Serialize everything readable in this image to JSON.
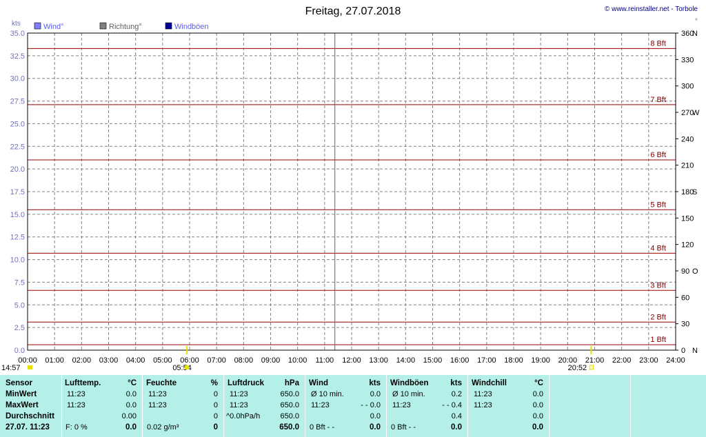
{
  "chart_data": {
    "type": "line",
    "title": "Freitag, 27.07.2018",
    "credit": "© www.reinstaller.net - Torbole",
    "legend": [
      {
        "label": "Wind°",
        "color": "#8080ff",
        "text_color": "#5a5aff"
      },
      {
        "label": "Richtung°",
        "color": "#808080",
        "text_color": "#606060"
      },
      {
        "label": "Windböen",
        "color": "#000099",
        "text_color": "#5a5aff"
      }
    ],
    "y_left": {
      "unit": "kts",
      "min": 0,
      "max": 35,
      "step": 2.5,
      "ticks": [
        "0.0",
        "2.5",
        "5.0",
        "7.5",
        "10.0",
        "12.5",
        "15.0",
        "17.5",
        "20.0",
        "22.5",
        "25.0",
        "27.5",
        "30.0",
        "32.5",
        "35.0"
      ]
    },
    "y_right": {
      "unit": "°",
      "min": 0,
      "max": 360,
      "step": 30,
      "ticks": [
        {
          "v": 0,
          "label": "0",
          "dir": "N"
        },
        {
          "v": 30,
          "label": "30",
          "dir": ""
        },
        {
          "v": 60,
          "label": "60",
          "dir": ""
        },
        {
          "v": 90,
          "label": "90",
          "dir": "O"
        },
        {
          "v": 120,
          "label": "120",
          "dir": ""
        },
        {
          "v": 150,
          "label": "150",
          "dir": ""
        },
        {
          "v": 180,
          "label": "180",
          "dir": "S"
        },
        {
          "v": 210,
          "label": "210",
          "dir": ""
        },
        {
          "v": 240,
          "label": "240",
          "dir": ""
        },
        {
          "v": 270,
          "label": "270",
          "dir": "W"
        },
        {
          "v": 300,
          "label": "300",
          "dir": ""
        },
        {
          "v": 330,
          "label": "330",
          "dir": ""
        },
        {
          "v": 360,
          "label": "360",
          "dir": "N"
        }
      ]
    },
    "x": {
      "min_hours": 0,
      "max_hours": 24,
      "ticks": [
        "00:00",
        "01:00",
        "02:00",
        "03:00",
        "04:00",
        "05:00",
        "06:00",
        "07:00",
        "08:00",
        "09:00",
        "10:00",
        "11:00",
        "12:00",
        "13:00",
        "14:00",
        "15:00",
        "16:00",
        "17:00",
        "18:00",
        "19:00",
        "20:00",
        "21:00",
        "22:00",
        "23:00",
        "24:00"
      ]
    },
    "beaufort": [
      {
        "label": "1 Bft",
        "kts": 0.6
      },
      {
        "label": "2 Bft",
        "kts": 3.1
      },
      {
        "label": "3 Bft",
        "kts": 6.6
      },
      {
        "label": "4 Bft",
        "kts": 10.7
      },
      {
        "label": "5 Bft",
        "kts": 15.5
      },
      {
        "label": "6 Bft",
        "kts": 21.0
      },
      {
        "label": "7 Bft",
        "kts": 27.1
      },
      {
        "label": "8 Bft",
        "kts": 33.3
      }
    ],
    "current_time_hours": 11.38,
    "sunrise": {
      "label": "05:54",
      "hours": 5.9
    },
    "sunset": {
      "label": "20:52",
      "hours": 20.87
    },
    "day_start": "14:57",
    "grid": true,
    "series": []
  },
  "table": {
    "row_labels": [
      "Sensor",
      "MinWert",
      "MaxWert",
      "Durchschnitt",
      "27.07. 11:23"
    ],
    "groups": [
      {
        "title": "Lufttemp.",
        "unit": "°C",
        "min": [
          "11:23",
          "0.0"
        ],
        "max": [
          "11:23",
          "0.0"
        ],
        "avg": "0.00",
        "cur": [
          "F: 0 %",
          "0.0"
        ]
      },
      {
        "title": "Feuchte",
        "unit": "%",
        "min": [
          "11:23",
          "0"
        ],
        "max": [
          "11:23",
          "0"
        ],
        "avg": "0",
        "cur": [
          "0.02 g/m³",
          "0"
        ]
      },
      {
        "title": "Luftdruck",
        "unit": "hPa",
        "min": [
          "11:23",
          "650.0"
        ],
        "max": [
          "11:23",
          "650.0"
        ],
        "avg_left": "^0.0hPa/h",
        "avg": "650.0",
        "cur": [
          "",
          "650.0"
        ]
      },
      {
        "title": "Wind",
        "unit": "kts",
        "min": [
          "Ø 10 min.",
          "0.0"
        ],
        "max": [
          "11:23",
          "- - 0.0"
        ],
        "avg": "0.0",
        "cur": [
          "0 Bft - -",
          "0.0"
        ]
      },
      {
        "title": "Windböen",
        "unit": "kts",
        "min": [
          "Ø 10 min.",
          "0.2"
        ],
        "max": [
          "11:23",
          "- - 0.4"
        ],
        "avg": "0.4",
        "cur": [
          "0 Bft - -",
          "0.0"
        ]
      },
      {
        "title": "Windchill",
        "unit": "°C",
        "min": [
          "11:23",
          "0.0"
        ],
        "max": [
          "11:23",
          "0.0"
        ],
        "avg": "0.0",
        "cur": [
          "",
          "0.0"
        ]
      }
    ]
  }
}
